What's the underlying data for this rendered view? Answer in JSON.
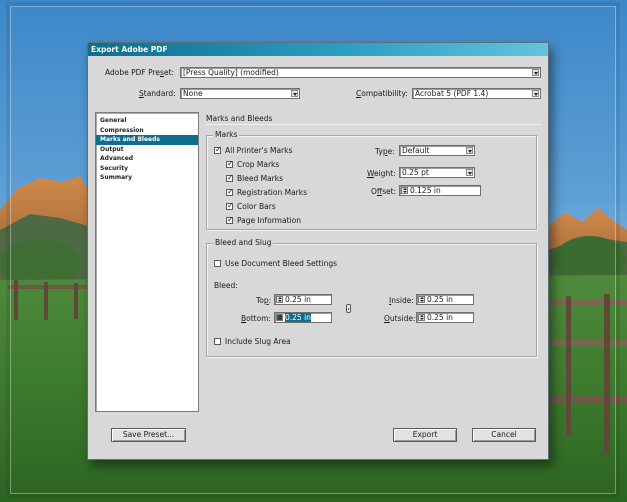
{
  "dialog": {
    "title": "Export Adobe PDF",
    "preset_label": "Adobe PDF Preset:",
    "preset_value": "[Press Quality] (modified)",
    "standard_label": "Standard:",
    "standard_value": "None",
    "compat_label": "Compatibility:",
    "compat_value": "Acrobat 5 (PDF 1.4)"
  },
  "sidebar": {
    "items": [
      {
        "label": "General"
      },
      {
        "label": "Compression"
      },
      {
        "label": "Marks and Bleeds"
      },
      {
        "label": "Output"
      },
      {
        "label": "Advanced"
      },
      {
        "label": "Security"
      },
      {
        "label": "Summary"
      }
    ],
    "selected": "Marks and Bleeds"
  },
  "panel": {
    "heading": "Marks and Bleeds",
    "marks": {
      "title": "Marks",
      "all_printers_marks": "All Printer's Marks",
      "crop_marks": "Crop Marks",
      "bleed_marks": "Bleed Marks",
      "registration_marks": "Registration Marks",
      "color_bars": "Color Bars",
      "page_information": "Page Information",
      "checked": {
        "all_printers_marks": true,
        "crop_marks": true,
        "bleed_marks": true,
        "registration_marks": true,
        "color_bars": true,
        "page_information": true
      },
      "type_label": "Type:",
      "type_value": "Default",
      "weight_label": "Weight:",
      "weight_value": "0.25 pt",
      "offset_label": "Offset:",
      "offset_value": "0.125 in"
    },
    "bleed_slug": {
      "title": "Bleed and Slug",
      "use_doc_bleed": "Use Document Bleed Settings",
      "bleed_label": "Bleed:",
      "top_label": "Top:",
      "top_value": "0.25 in",
      "bottom_label": "Bottom:",
      "bottom_value": "0.25 in",
      "inside_label": "Inside:",
      "inside_value": "0.25 in",
      "outside_label": "Outside:",
      "outside_value": "0.25 in",
      "include_slug": "Include Slug Area",
      "checked": {
        "use_doc_bleed": false,
        "include_slug": false
      }
    }
  },
  "buttons": {
    "save_preset": "Save Preset...",
    "export": "Export",
    "cancel": "Cancel"
  },
  "colors": {
    "accent": "#0d6e8e",
    "dialog_bg": "#d8d8d8"
  }
}
